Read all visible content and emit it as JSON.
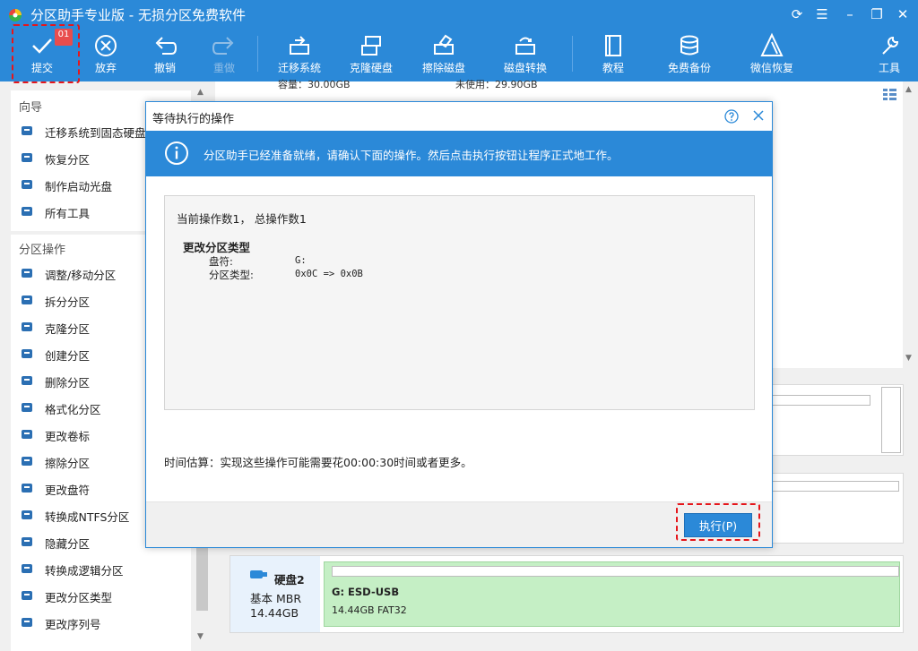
{
  "app": {
    "title": "分区助手专业版 - 无损分区免费软件"
  },
  "toolbar": {
    "commit_label": "提交",
    "commit_badge": "01",
    "discard_label": "放弃",
    "undo_label": "撤销",
    "redo_label": "重做",
    "migrate_label": "迁移系统",
    "clone_label": "克隆硬盘",
    "wipe_label": "擦除磁盘",
    "convert_label": "磁盘转换",
    "tutorial_label": "教程",
    "backup_label": "免费备份",
    "wechat_label": "微信恢复",
    "tools_label": "工具"
  },
  "sidebar": {
    "wizard_heading": "向导",
    "wizard_items": [
      {
        "label": "迁移系统到固态硬盘",
        "icon": "migrate-ssd-icon"
      },
      {
        "label": "恢复分区",
        "icon": "recover-partition-icon"
      },
      {
        "label": "制作启动光盘",
        "icon": "bootable-media-icon"
      },
      {
        "label": "所有工具",
        "icon": "all-tools-icon"
      }
    ],
    "ops_heading": "分区操作",
    "ops_items": [
      {
        "label": "调整/移动分区",
        "icon": "resize-partition-icon"
      },
      {
        "label": "拆分分区",
        "icon": "split-partition-icon"
      },
      {
        "label": "克隆分区",
        "icon": "clone-partition-icon"
      },
      {
        "label": "创建分区",
        "icon": "create-partition-icon"
      },
      {
        "label": "删除分区",
        "icon": "delete-partition-icon"
      },
      {
        "label": "格式化分区",
        "icon": "format-partition-icon"
      },
      {
        "label": "更改卷标",
        "icon": "label-tag-icon"
      },
      {
        "label": "擦除分区",
        "icon": "wipe-partition-icon"
      },
      {
        "label": "更改盘符",
        "icon": "drive-letter-icon"
      },
      {
        "label": "转换成NTFS分区",
        "icon": "convert-ntfs-icon"
      },
      {
        "label": "隐藏分区",
        "icon": "hide-partition-icon"
      },
      {
        "label": "转换成逻辑分区",
        "icon": "convert-logical-icon"
      },
      {
        "label": "更改分区类型",
        "icon": "id-icon"
      },
      {
        "label": "更改序列号",
        "icon": "serial-number-icon"
      }
    ]
  },
  "main": {
    "partial_row_left": "容量：30.00GB",
    "partial_row_right": "未使用：29.90GB"
  },
  "dialog": {
    "title": "等待执行的操作",
    "info_text": "分区助手已经准备就绪，请确认下面的操作。然后点击执行按钮让程序正式地工作。",
    "ops_count": "当前操作数1， 总操作数1",
    "op_title": "更改分区类型",
    "op_drive_label": "盘符:",
    "op_drive_value": "G:",
    "op_type_label": "分区类型:",
    "op_type_value": "0x0C => 0x0B",
    "time_estimate": "时间估算：实现这些操作可能需要花00:00:30时间或者更多。",
    "execute_label": "执行(P)"
  },
  "disk2": {
    "name": "硬盘2",
    "type": "基本 MBR",
    "size": "14.44GB",
    "partition_name": "G: ESD-USB",
    "partition_info": "14.44GB FAT32"
  },
  "colors": {
    "accent": "#2b89d8",
    "highlight_dash": "#e5161b",
    "partition_green": "#c5efc5"
  }
}
